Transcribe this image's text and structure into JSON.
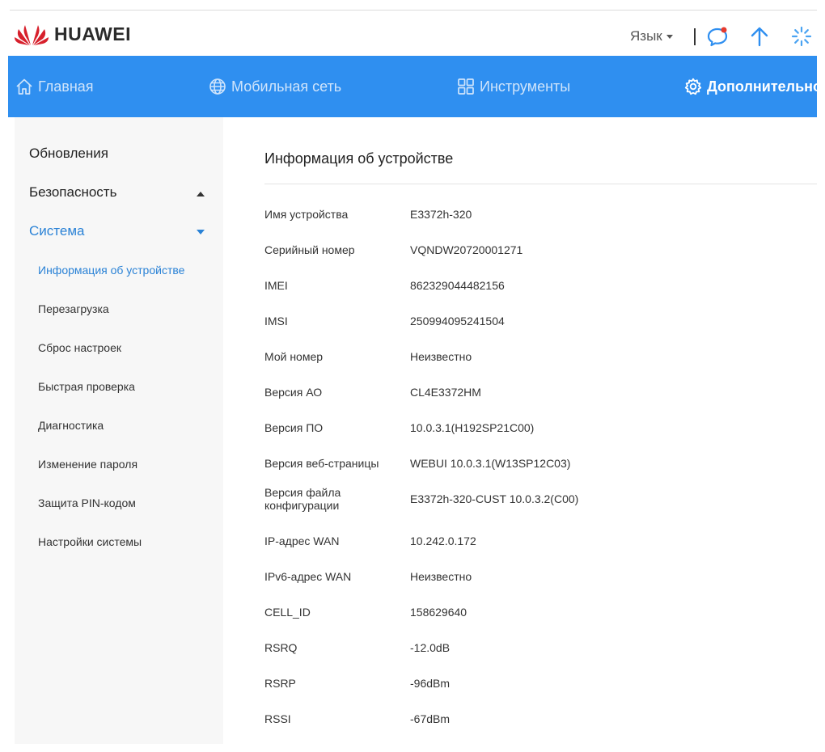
{
  "header": {
    "brand": "HUAWEI",
    "language_label": "Язык",
    "icons": [
      "message-icon",
      "update-arrow-icon",
      "loading-spinner-icon"
    ]
  },
  "nav": {
    "items": [
      {
        "label": "Главная",
        "icon": "home-icon"
      },
      {
        "label": "Мобильная сеть",
        "icon": "globe-icon"
      },
      {
        "label": "Инструменты",
        "icon": "tools-grid-icon"
      },
      {
        "label": "Дополнительно",
        "icon": "gear-icon",
        "active": true
      }
    ],
    "color": "#2f8ff0"
  },
  "sidebar": {
    "sections": [
      {
        "label": "Обновления"
      },
      {
        "label": "Безопасность",
        "state": "collapsed"
      },
      {
        "label": "Система",
        "state": "expanded",
        "active": true
      }
    ],
    "sub_items": [
      {
        "label": "Информация об устройстве",
        "active": true
      },
      {
        "label": "Перезагрузка"
      },
      {
        "label": "Сброс настроек"
      },
      {
        "label": "Быстрая проверка"
      },
      {
        "label": "Диагностика"
      },
      {
        "label": "Изменение пароля"
      },
      {
        "label": "Защита PIN-кодом"
      },
      {
        "label": "Настройки системы"
      }
    ],
    "active_color": "#2a82d6"
  },
  "main": {
    "title": "Информация об устройстве",
    "rows": [
      {
        "label": "Имя устройства",
        "value": "E3372h-320"
      },
      {
        "label": "Серийный номер",
        "value": "VQNDW20720001271"
      },
      {
        "label": "IMEI",
        "value": "862329044482156"
      },
      {
        "label": "IMSI",
        "value": "250994095241504"
      },
      {
        "label": "Мой номер",
        "value": "Неизвестно"
      },
      {
        "label": "Версия АО",
        "value": "CL4E3372HM"
      },
      {
        "label": "Версия ПО",
        "value": "10.0.3.1(H192SP21C00)"
      },
      {
        "label": "Версия веб-страницы",
        "value": "WEBUI 10.0.3.1(W13SP12C03)"
      },
      {
        "label": "Версия файла конфигурации",
        "value": "E3372h-320-CUST 10.0.3.2(C00)"
      },
      {
        "label": "IP-адрес WAN",
        "value": "10.242.0.172"
      },
      {
        "label": "IPv6-адрес WAN",
        "value": "Неизвестно"
      },
      {
        "label": "CELL_ID",
        "value": "158629640"
      },
      {
        "label": "RSRQ",
        "value": "-12.0dB"
      },
      {
        "label": "RSRP",
        "value": "-96dBm"
      },
      {
        "label": "RSSI",
        "value": "-67dBm"
      }
    ]
  }
}
